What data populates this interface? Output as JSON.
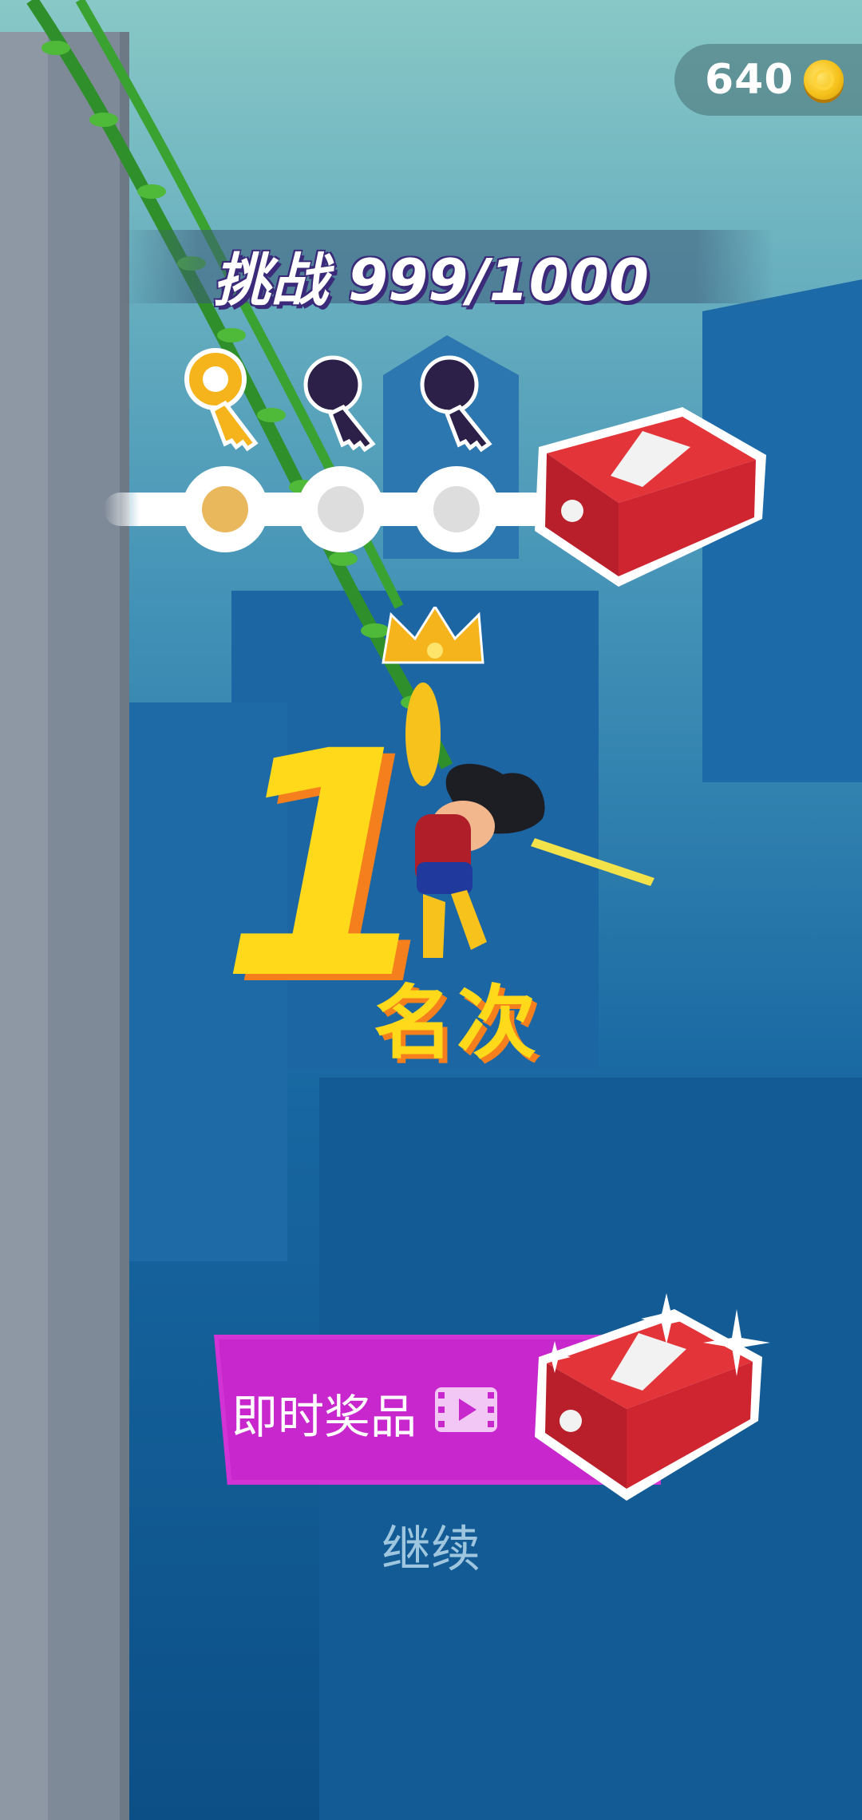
{
  "coins": {
    "value": "640"
  },
  "challenge": {
    "label": "挑战 999/1000"
  },
  "progress": {
    "keys_collected": 1,
    "keys_total": 3
  },
  "rank": {
    "number": "1",
    "label": "名次"
  },
  "reward_button": {
    "label": "即时奖品"
  },
  "continue_label": "继续",
  "colors": {
    "reward_button": "#c727cc",
    "rank_text": "#ffd91a",
    "rank_shadow": "#f57f1c",
    "sky": "#7fc1c7",
    "water": "#10588e"
  }
}
